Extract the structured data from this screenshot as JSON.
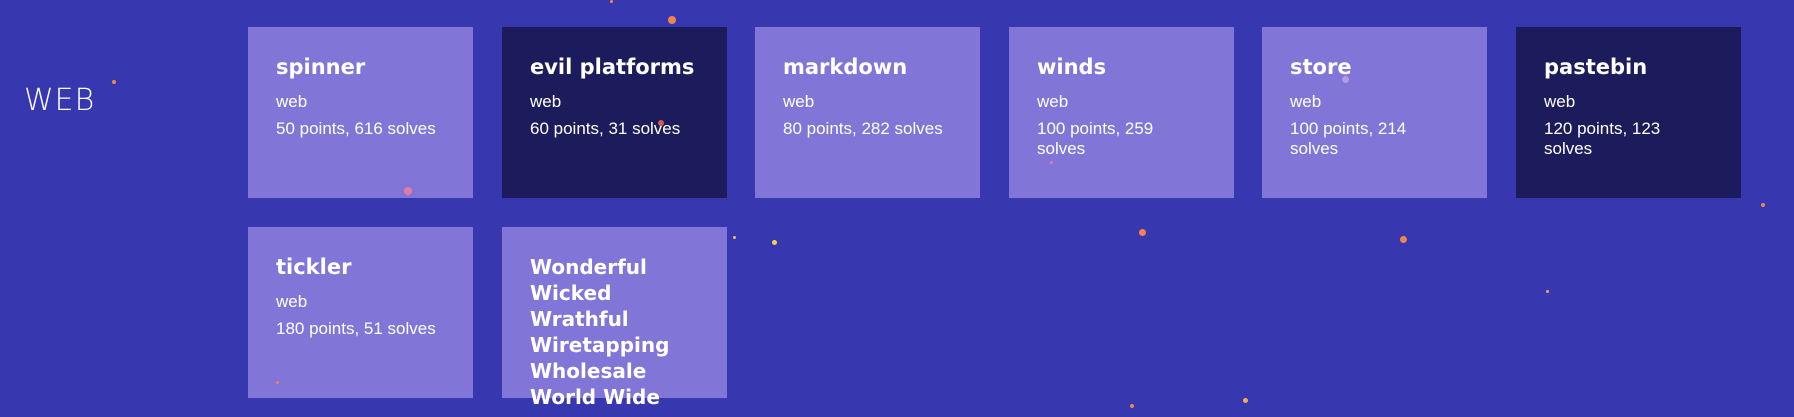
{
  "category": {
    "title": "WEB"
  },
  "challenges": [
    {
      "title": "spinner",
      "category": "web",
      "meta": "50 points, 616 solves",
      "solved": false
    },
    {
      "title": "evil platforms",
      "category": "web",
      "meta": "60 points, 31 solves",
      "solved": true
    },
    {
      "title": "markdown",
      "category": "web",
      "meta": "80 points, 282 solves",
      "solved": false
    },
    {
      "title": "winds",
      "category": "web",
      "meta": "100 points, 259 solves",
      "solved": false
    },
    {
      "title": "store",
      "category": "web",
      "meta": "100 points, 214 solves",
      "solved": false
    },
    {
      "title": "pastebin",
      "category": "web",
      "meta": "120 points, 123 solves",
      "solved": true
    },
    {
      "title": "tickler",
      "category": "web",
      "meta": "180 points, 51 solves",
      "solved": false
    },
    {
      "title": "Wonderful\nWicked\nWrathful\nWiretapping\nWholesale\nWorld Wide",
      "category": "",
      "meta": "",
      "solved": false
    }
  ],
  "colors": {
    "background": "#3737b0",
    "card": "#8175d8",
    "card_solved": "#1c1c5c",
    "particle": "#f4844a"
  }
}
